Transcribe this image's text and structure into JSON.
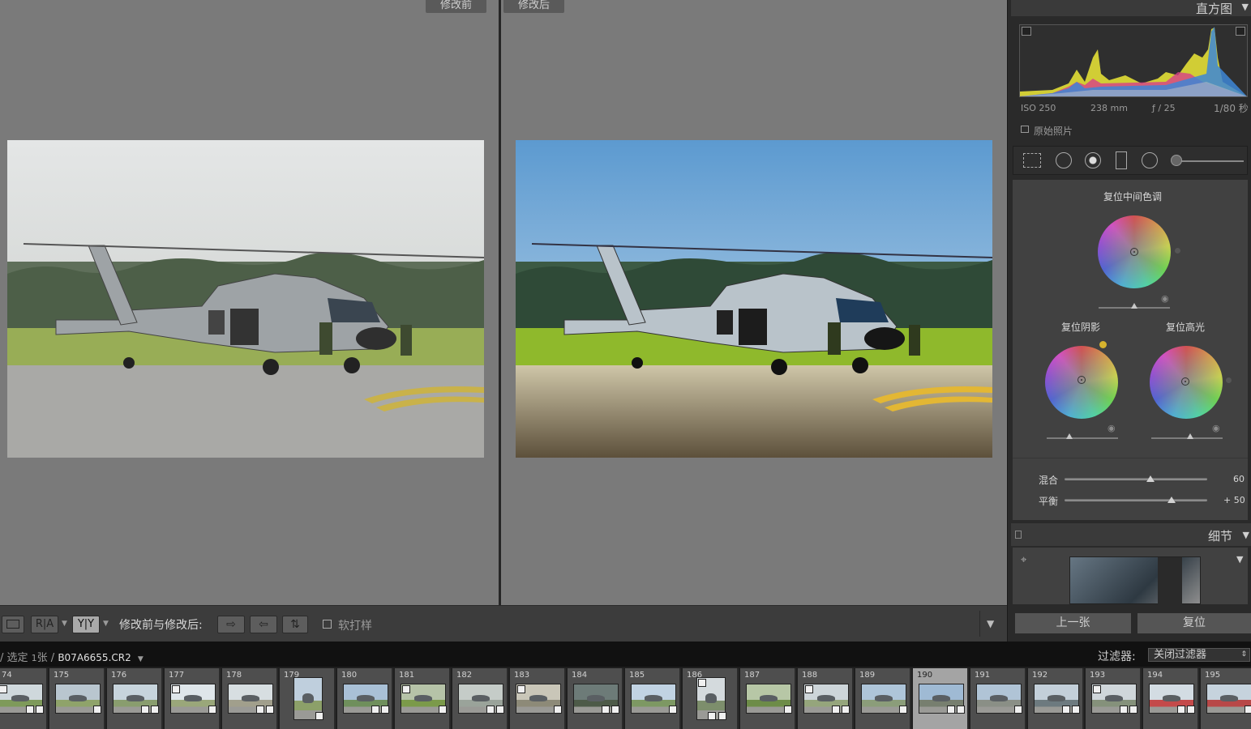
{
  "compare": {
    "before_label": "修改前",
    "after_label": "修改后"
  },
  "toolbar": {
    "view_mode_label": "修改前与修改后:",
    "soft_proof_label": "软打样",
    "ra_label": "R|A",
    "yy_label": "Y|Y"
  },
  "histogram": {
    "title": "直方图",
    "iso": "ISO 250",
    "focal": "238 mm",
    "aperture": "ƒ / 25",
    "shutter": "1/80 秒",
    "original_photo_label": "原始照片"
  },
  "color_grading": {
    "midtones_label": "复位中间色调",
    "shadows_label": "复位阴影",
    "highlights_label": "复位高光",
    "blend_label": "混合",
    "blend_value": "60",
    "blend_fraction": 0.6,
    "balance_label": "平衡",
    "balance_value": "+ 50",
    "balance_fraction": 0.75
  },
  "detail": {
    "title": "细节"
  },
  "nav": {
    "prev_label": "上一张",
    "reset_label": "复位"
  },
  "infobar": {
    "path_prefix": "/ 选定",
    "count": "1",
    "unit": "张 /",
    "filename": "B07A6655.CR2",
    "filter_label": "过滤器:",
    "filter_value": "关闭过滤器"
  },
  "filmstrip": {
    "numbers": [
      "74",
      "175",
      "176",
      "177",
      "178",
      "179",
      "180",
      "181",
      "182",
      "183",
      "184",
      "185",
      "186",
      "187",
      "188",
      "189",
      "190",
      "191",
      "192",
      "193",
      "194",
      "195"
    ],
    "selected_index": 16
  },
  "colors": {
    "accent": "#a4a4a4",
    "canvas": "#7a7a7a"
  }
}
